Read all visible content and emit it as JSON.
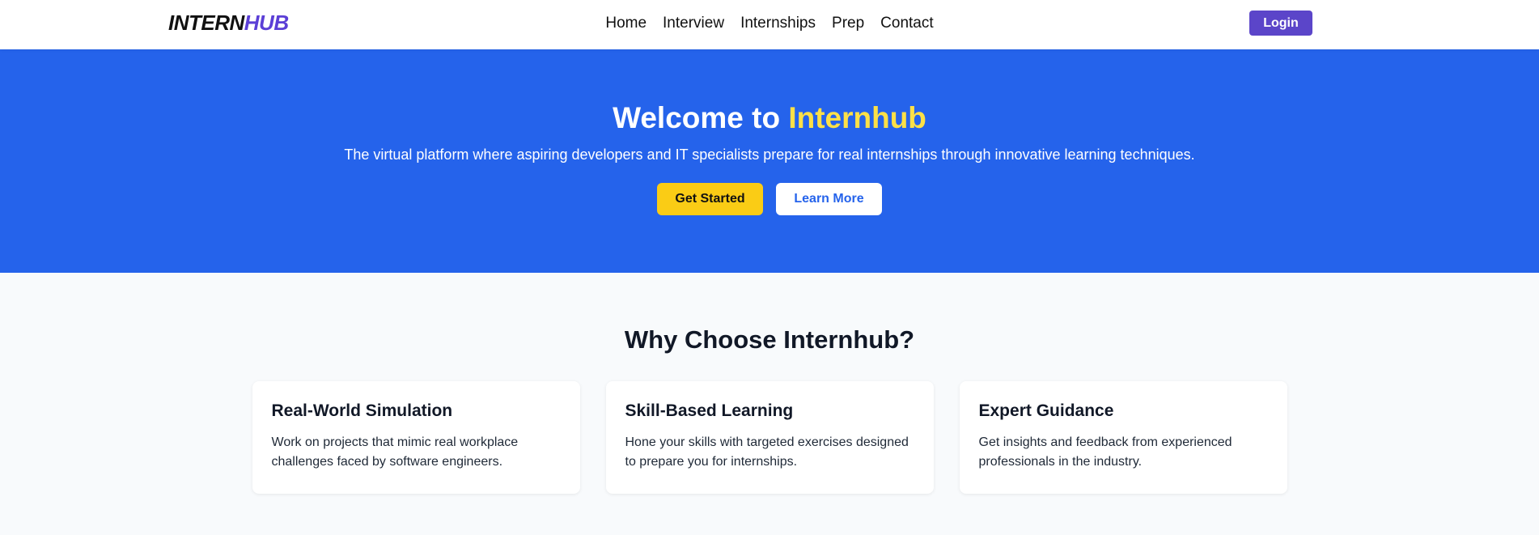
{
  "navbar": {
    "logo_main": "INTERN",
    "logo_accent": "HUB",
    "links": [
      "Home",
      "Interview",
      "Internships",
      "Prep",
      "Contact"
    ],
    "login_label": "Login"
  },
  "hero": {
    "title_prefix": "Welcome to ",
    "title_highlight": "Internhub",
    "subtitle": "The virtual platform where aspiring developers and IT specialists prepare for real internships through innovative learning techniques.",
    "primary_button": "Get Started",
    "secondary_button": "Learn More"
  },
  "features": {
    "title": "Why Choose Internhub?",
    "cards": [
      {
        "title": "Real-World Simulation",
        "text": "Work on projects that mimic real workplace challenges faced by software engineers."
      },
      {
        "title": "Skill-Based Learning",
        "text": "Hone your skills with targeted exercises designed to prepare you for internships."
      },
      {
        "title": "Expert Guidance",
        "text": "Get insights and feedback from experienced professionals in the industry."
      }
    ]
  },
  "colors": {
    "brand": "#5b45c9",
    "hero_bg": "#2563eb",
    "highlight": "#fde047",
    "primary_button": "#facc15"
  }
}
